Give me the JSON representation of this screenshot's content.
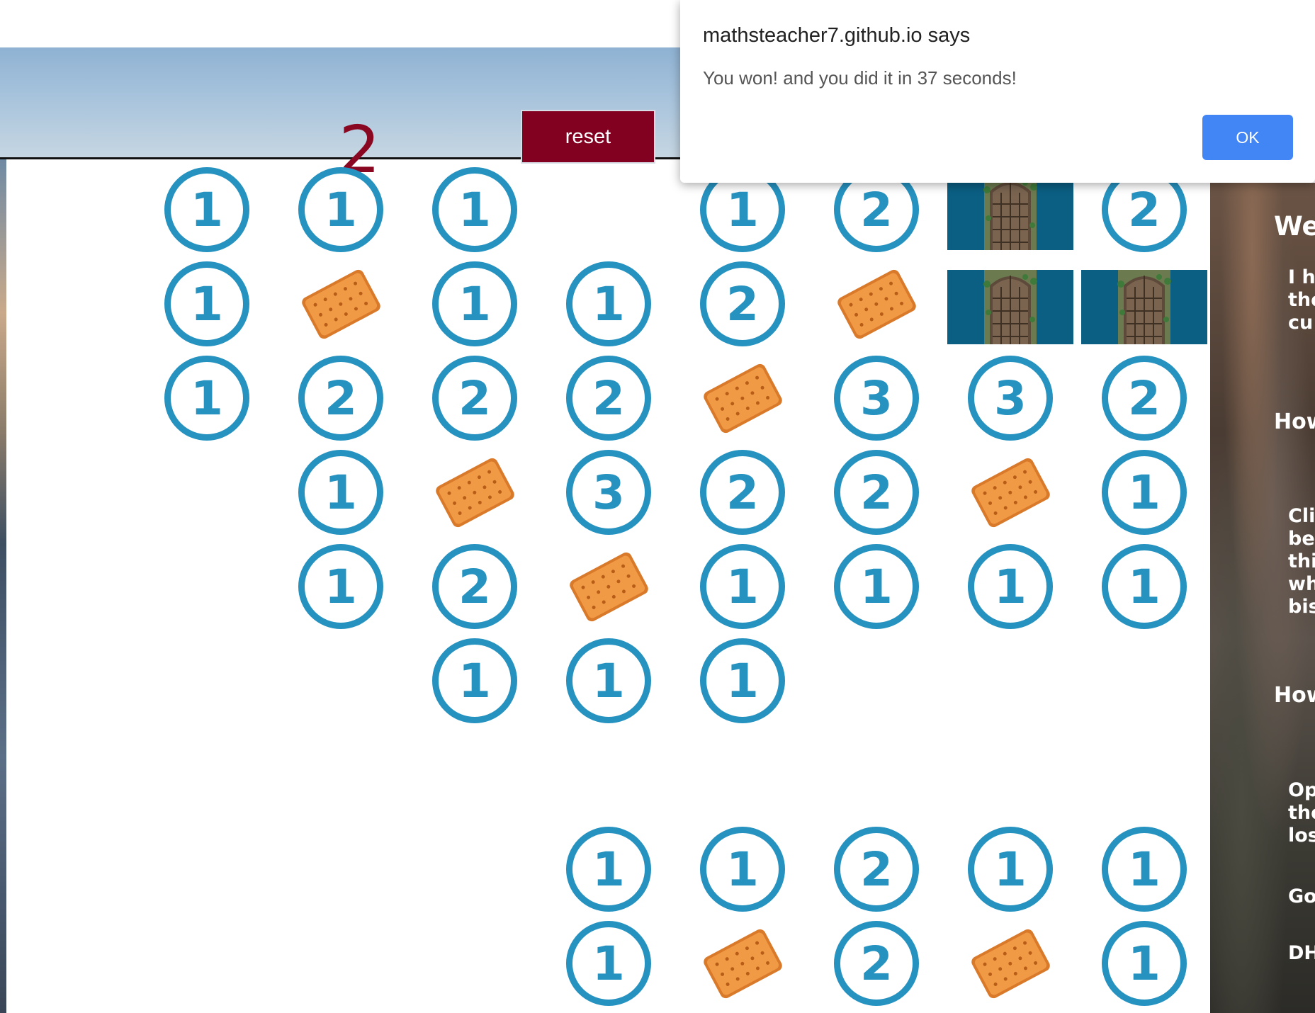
{
  "header": {
    "counter": "2",
    "reset_label": "reset"
  },
  "dialog": {
    "title": "mathsteacher7.github.io says",
    "message": "You won! and you did it in 37 seconds!",
    "ok_label": "OK"
  },
  "info_panel": {
    "lines": [
      "We",
      "I h",
      "the",
      "cu",
      "How",
      "Cli",
      "be",
      "thi",
      "wh",
      "bis",
      "How",
      "Op",
      "the",
      "los",
      "Go",
      "DH"
    ]
  },
  "board": {
    "rows": [
      [
        "1",
        "1",
        "1",
        "",
        "1",
        "2",
        "door",
        "2"
      ],
      [
        "1",
        "biscuit",
        "1",
        "1",
        "2",
        "biscuit",
        "door",
        "door"
      ],
      [
        "1",
        "2",
        "2",
        "2",
        "biscuit",
        "3",
        "3",
        "2"
      ],
      [
        "",
        "1",
        "biscuit",
        "3",
        "2",
        "2",
        "biscuit",
        "1"
      ],
      [
        "",
        "1",
        "2",
        "biscuit",
        "1",
        "1",
        "1",
        "1"
      ],
      [
        "",
        "",
        "1",
        "1",
        "1",
        "",
        "",
        ""
      ],
      [
        "",
        "",
        "",
        "",
        "",
        "",
        "",
        ""
      ],
      [
        "",
        "",
        "",
        "1",
        "1",
        "2",
        "1",
        "1"
      ],
      [
        "",
        "",
        "",
        "1",
        "biscuit",
        "2",
        "biscuit",
        "1"
      ]
    ]
  },
  "colors": {
    "number": "#2592c0",
    "reset": "#820020",
    "counter": "#8a0721",
    "door_bg": "#0b5f83",
    "ok": "#4285f4"
  }
}
